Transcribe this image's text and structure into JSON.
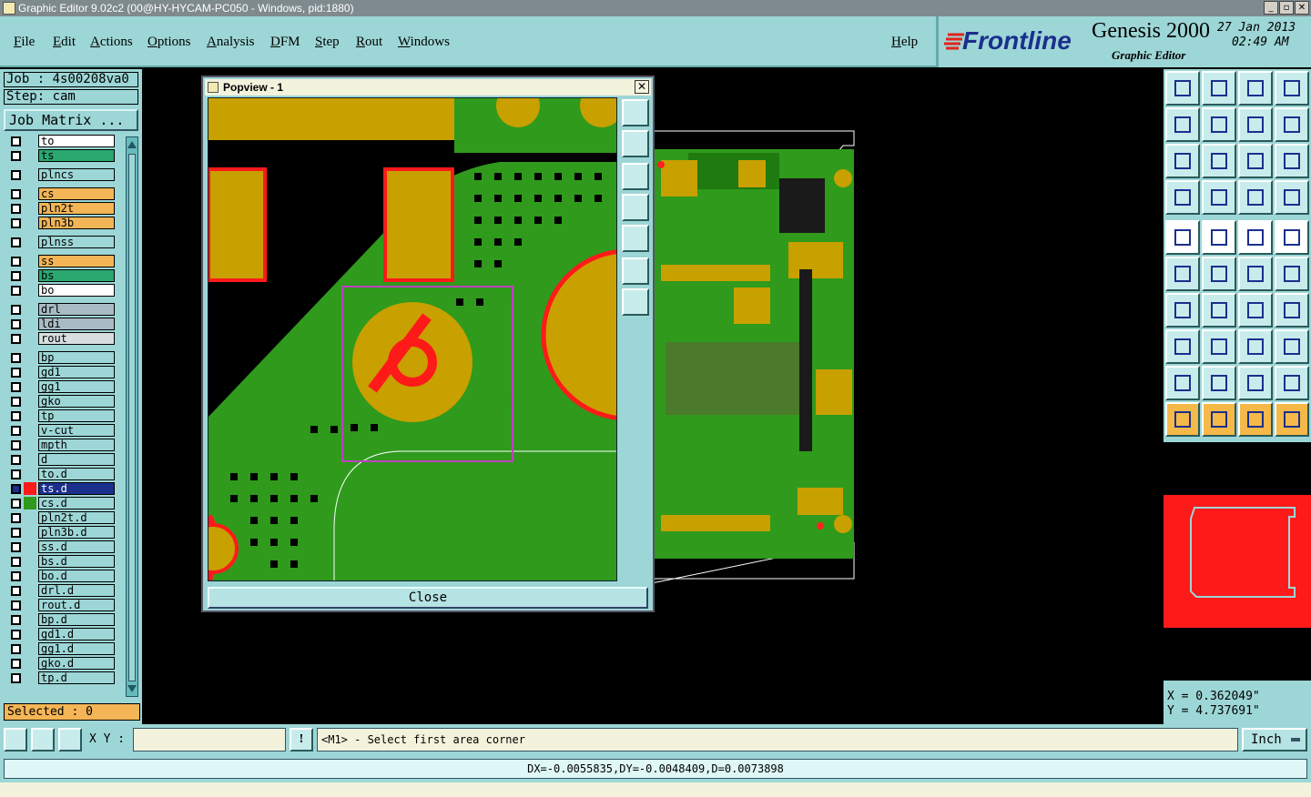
{
  "window": {
    "title": "Graphic Editor 9.02c2 (00@HY-HYCAM-PC050 - Windows, pid:1880)",
    "buttons": [
      "_",
      "▫",
      "✕"
    ]
  },
  "menu": {
    "items": [
      "File",
      "Edit",
      "Actions",
      "Options",
      "Analysis",
      "DFM",
      "Step",
      "Rout",
      "Windows"
    ],
    "help": "Help"
  },
  "brand": {
    "logo": "Frontline",
    "product": "Genesis 2000",
    "subtitle": "Graphic Editor",
    "date": "27 Jan 2013",
    "time": "02:49 AM"
  },
  "job": {
    "job_label": "Job : 4s00208va0",
    "step_label": "Step: cam",
    "matrix_button": "Job Matrix ..."
  },
  "layers": [
    {
      "name": "to",
      "color": "#ffffff"
    },
    {
      "name": "ts",
      "color": "#2aa870"
    },
    {
      "name": "plncs",
      "color": "#9dd6d6"
    },
    {
      "name": "cs",
      "color": "#f4b556"
    },
    {
      "name": "pln2t",
      "color": "#f4b556"
    },
    {
      "name": "pln3b",
      "color": "#f4b556"
    },
    {
      "name": "plnss",
      "color": "#9dd6d6"
    },
    {
      "name": "ss",
      "color": "#f4b556"
    },
    {
      "name": "bs",
      "color": "#2aa870"
    },
    {
      "name": "bo",
      "color": "#ffffff"
    },
    {
      "name": "drl",
      "color": "#a8bcc4"
    },
    {
      "name": "ldi",
      "color": "#a8bcc4"
    },
    {
      "name": "rout",
      "color": "#d8dede"
    },
    {
      "name": "bp",
      "color": "#9dd6d6"
    },
    {
      "name": "gd1",
      "color": "#9dd6d6"
    },
    {
      "name": "gg1",
      "color": "#9dd6d6"
    },
    {
      "name": "gko",
      "color": "#9dd6d6"
    },
    {
      "name": "tp",
      "color": "#9dd6d6"
    },
    {
      "name": "v-cut",
      "color": "#9dd6d6"
    },
    {
      "name": "mpth",
      "color": "#9dd6d6"
    },
    {
      "name": "d",
      "color": "#9dd6d6"
    },
    {
      "name": "to.d",
      "color": "#9dd6d6"
    },
    {
      "name": "ts.d",
      "color": "#9dd6d6"
    },
    {
      "name": "cs.d",
      "color": "#9dd6d6"
    },
    {
      "name": "pln2t.d",
      "color": "#9dd6d6"
    },
    {
      "name": "pln3b.d",
      "color": "#9dd6d6"
    },
    {
      "name": "ss.d",
      "color": "#9dd6d6"
    },
    {
      "name": "bs.d",
      "color": "#9dd6d6"
    },
    {
      "name": "bo.d",
      "color": "#9dd6d6"
    },
    {
      "name": "drl.d",
      "color": "#9dd6d6"
    },
    {
      "name": "rout.d",
      "color": "#9dd6d6"
    },
    {
      "name": "bp.d",
      "color": "#9dd6d6"
    },
    {
      "name": "gd1.d",
      "color": "#9dd6d6"
    },
    {
      "name": "gg1.d",
      "color": "#9dd6d6"
    },
    {
      "name": "gko.d",
      "color": "#9dd6d6"
    },
    {
      "name": "tp.d",
      "color": "#9dd6d6"
    }
  ],
  "selected_label": "Selected : 0",
  "popview": {
    "title": "Popview - 1",
    "close_label": "Close"
  },
  "coords": {
    "x": "X = 0.362049\"",
    "y": "Y = 4.737691\""
  },
  "command": {
    "xy_label": "X Y :",
    "xy_value": "",
    "prompt": "<M1> - Select first area corner",
    "units": "Inch"
  },
  "status": "DX=-0.0055835,DY=-0.0048409,D=0.0073898",
  "colors": {
    "panel": "#9dd6d6",
    "copper": "#c8a000",
    "mask": "#2f9a1c",
    "highlight": "#ff1a1a",
    "selection": "#c040c0"
  }
}
